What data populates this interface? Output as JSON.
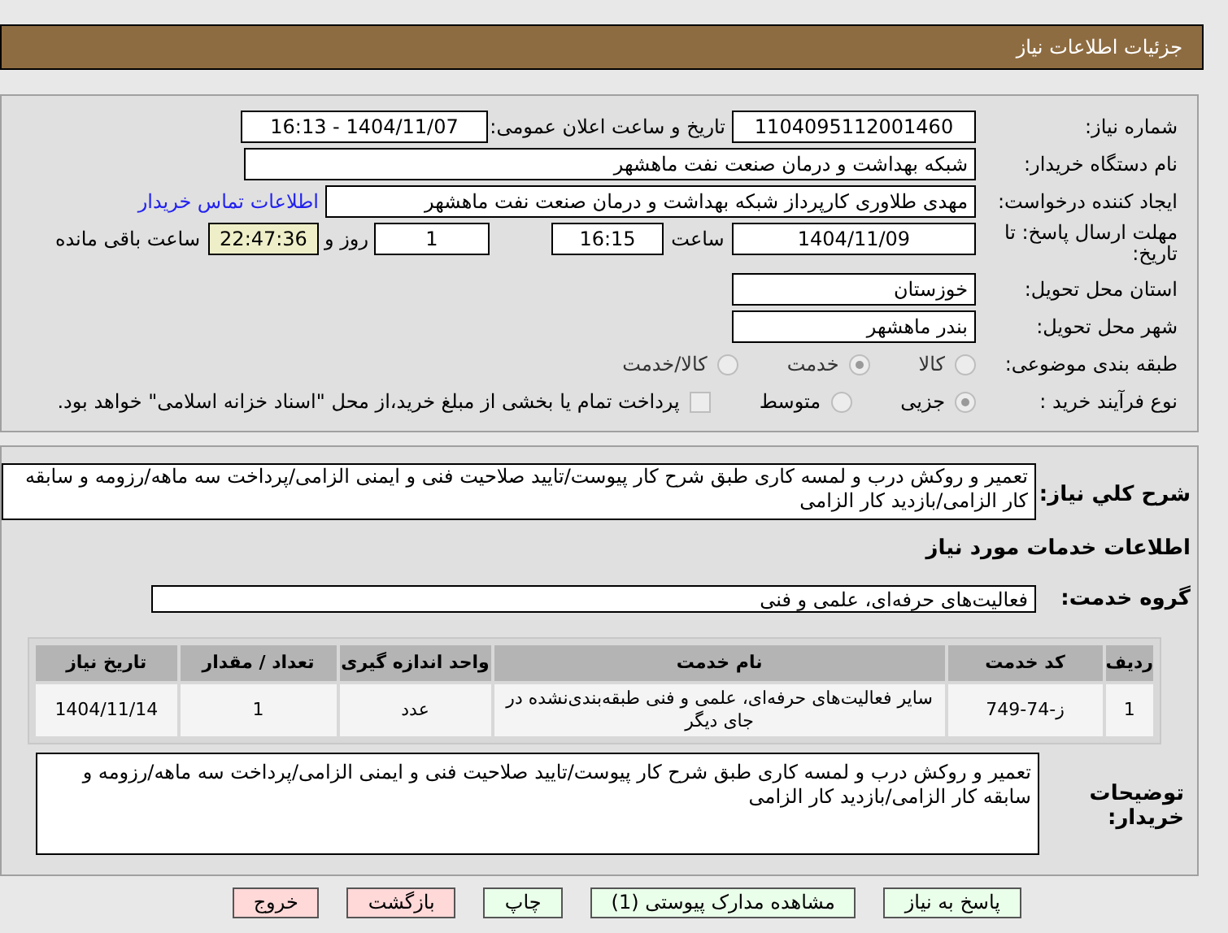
{
  "header": {
    "title": "جزئیات اطلاعات نیاز"
  },
  "fields": {
    "need_number": {
      "label": "شماره نیاز:",
      "value": "1104095112001460"
    },
    "announce": {
      "label": "تاریخ و ساعت اعلان عمومی:",
      "value": "1404/11/07 - 16:13"
    },
    "buyer": {
      "label": "نام دستگاه خریدار:",
      "value": "شبکه بهداشت و درمان صنعت نفت ماهشهر"
    },
    "creator": {
      "label": "ایجاد کننده درخواست:",
      "value": "مهدی طلاوری کارپرداز شبکه بهداشت و درمان صنعت نفت ماهشهر",
      "link": "اطلاعات تماس خریدار"
    },
    "deadline": {
      "label": "مهلت ارسال پاسخ: تا تاریخ:",
      "date": "1404/11/09",
      "time_label": "ساعت",
      "time": "16:15",
      "days": "1",
      "days_label": "روز و",
      "remaining": "22:47:36",
      "remaining_label": "ساعت باقی مانده"
    },
    "province": {
      "label": "استان محل تحویل:",
      "value": "خوزستان"
    },
    "city": {
      "label": "شهر محل تحویل:",
      "value": "بندر ماهشهر"
    }
  },
  "category": {
    "label": "طبقه بندی موضوعی:",
    "options": [
      {
        "label": "کالا",
        "selected": false
      },
      {
        "label": "خدمت",
        "selected": true
      },
      {
        "label": "کالا/خدمت",
        "selected": false
      }
    ]
  },
  "process": {
    "label": "نوع فرآیند خرید :",
    "options": [
      {
        "label": "جزیی",
        "selected": true
      },
      {
        "label": "متوسط",
        "selected": false
      }
    ],
    "payment": {
      "checked": false,
      "text": "پرداخت تمام یا بخشی از مبلغ خرید،از محل \"اسناد خزانه اسلامی\" خواهد بود."
    }
  },
  "description": {
    "label": "شرح کلي نیاز:",
    "value": "تعمیر و روکش درب و لمسه کاری طبق شرح کار پیوست/تایید صلاحیت فنی و ایمنی الزامی/پرداخت سه ماهه/رزومه و سابقه کار الزامی/بازدید کار الزامی"
  },
  "services_title": "اطلاعات خدمات مورد نیاز",
  "service_group": {
    "label": "گروه خدمت:",
    "value": "فعالیت‌های حرفه‌ای، علمی و فنی"
  },
  "table": {
    "columns": [
      "ردیف",
      "کد خدمت",
      "نام خدمت",
      "واحد اندازه گیری",
      "تعداد / مقدار",
      "تاریخ نیاز"
    ],
    "rows": [
      [
        "1",
        "ز-74-749",
        "سایر فعالیت‌های حرفه‌ای، علمی و فنی طبقه‌بندی‌نشده در جای دیگر",
        "عدد",
        "1",
        "1404/11/14"
      ]
    ]
  },
  "buyer_notes": {
    "label": "توضیحات خریدار:",
    "value": "تعمیر و روکش درب و لمسه کاری طبق شرح کار پیوست/تایید صلاحیت فنی و ایمنی الزامی/پرداخت سه ماهه/رزومه و سابقه کار الزامی/بازدید کار الزامی"
  },
  "buttons": [
    {
      "label": "پاسخ به نیاز",
      "kind": "normal"
    },
    {
      "label": "مشاهده مدارک پیوستی (1)",
      "kind": "normal"
    },
    {
      "label": "چاپ",
      "kind": "normal"
    },
    {
      "label": "بازگشت",
      "kind": "danger"
    },
    {
      "label": "خروج",
      "kind": "danger"
    }
  ]
}
